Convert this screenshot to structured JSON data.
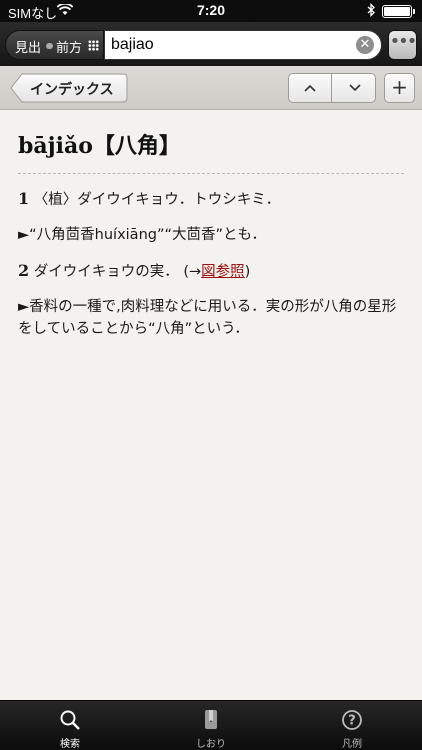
{
  "status": {
    "carrier": "SIMなし",
    "time": "7:20"
  },
  "search": {
    "mode_primary": "見出",
    "mode_secondary": "前方",
    "query": "bajiao"
  },
  "toolbar": {
    "back_label": "インデックス",
    "prev_symbol": "^",
    "next_symbol": "v",
    "add_symbol": "+"
  },
  "entry": {
    "headword": "bājiǎo【八角】",
    "sense1_num": "1",
    "sense1_text": "〈植〉ダイウイキョウ．トウシキミ．",
    "sense1_note": "►“八角茴香huíxiāng”“大茴香”とも．",
    "sense2_num": "2",
    "sense2_text": "ダイウイキョウの実．  (→",
    "sense2_link": "図参照",
    "sense2_close": ")",
    "sense2_note": "►香料の一種で,肉料理などに用いる．実の形が八角の星形をしていることから“八角”という．"
  },
  "tabs": [
    {
      "label": "検索",
      "icon": "search-icon",
      "active": true
    },
    {
      "label": "しおり",
      "icon": "bookmark-icon",
      "active": false
    },
    {
      "label": "凡例",
      "icon": "help-icon",
      "active": false
    }
  ],
  "colors": {
    "link": "#a01010",
    "bar": "#161616"
  }
}
